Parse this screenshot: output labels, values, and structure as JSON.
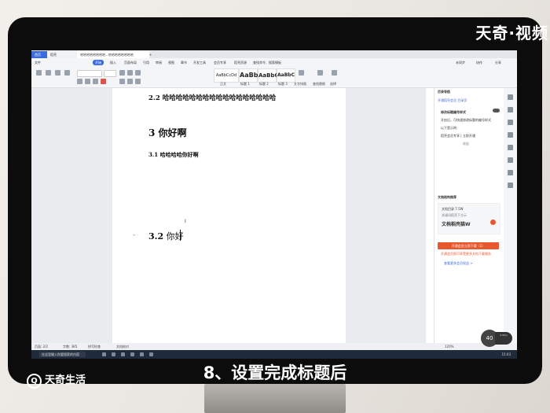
{
  "overlay": {
    "watermark": "天奇·视频",
    "caption": "8、设置完成标题后",
    "brand": "天奇生活",
    "brand_logo": "Q"
  },
  "app": {
    "tabs": {
      "home": "首页",
      "doc1": "稻壳",
      "doc2": "哈哈哈哈哈哈哈哈...哈哈哈哈哈哈哈哈",
      "plus": "+"
    },
    "menu": [
      "文件",
      "开始",
      "插入",
      "页面布局",
      "引用",
      "审阅",
      "视图",
      "章节",
      "开发工具",
      "会员专享",
      "稻壳资源",
      "查找命令、搜索模板"
    ],
    "menu_active": "开始",
    "right_menu": [
      "未同步",
      "协作",
      "分享"
    ],
    "styles": [
      {
        "preview": "AaBbCcDd",
        "label": "正文"
      },
      {
        "preview": "AaBb",
        "label": "标题 1"
      },
      {
        "preview": "AaBbC",
        "label": "标题 2"
      },
      {
        "preview": "AaBbC",
        "label": "标题 3"
      }
    ],
    "ribbon_right": [
      "文字排版",
      "查找替换",
      "选择"
    ]
  },
  "document": {
    "heading_2_2": "2.2 哈哈哈哈哈哈哈哈哈哈哈哈哈哈哈哈哈",
    "heading_3": "3 你好啊",
    "heading_3_1": "3.1 哈哈哈哈你好啊",
    "heading_3_2_num": "3.2",
    "heading_3_2_text": "你好",
    "gutter_mark": "≡ ·",
    "ibeam": "I"
  },
  "right_panel": {
    "title": "目录导航",
    "link": "开通稻壳会员 目录页",
    "option": "修改标题编号样式",
    "text1": "开启后，可快速修改标题的编号样式",
    "text2": "以下是示例：",
    "text3": "稻壳会员专享 | 立即开通",
    "expand": "收起",
    "section": "文档结构推荐",
    "card_title": "文档目录 7.5W",
    "card_sub": "关键词稻壳下方示",
    "card_main": "文档稻壳猫W",
    "button": "开通会员立即下载（1）",
    "warn": "开通会员即可享受更多文档下载服务",
    "more": "查看更多会员权益 >"
  },
  "statusbar": {
    "page": "页面: 2/2",
    "words": "字数: 385",
    "spell": "拼写检查",
    "compat": "文档校对",
    "zoom": "120%",
    "zoom_dial": "40",
    "zoom_side": "0.0K/s"
  },
  "taskbar": {
    "search": "在这里输入你要搜索的内容",
    "clock": "15:03"
  },
  "colors": {
    "accent": "#3c6bdc",
    "orange": "#e8582e",
    "screen_bg": "#ffffff",
    "bezel": "#0c0c0c"
  }
}
